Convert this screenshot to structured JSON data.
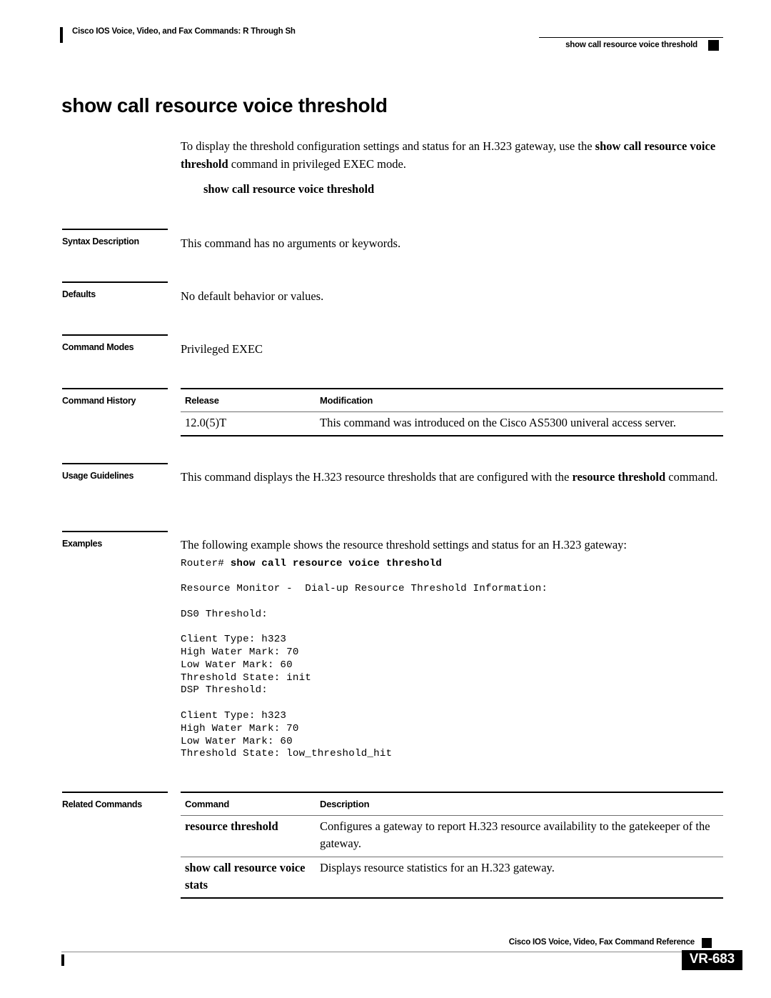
{
  "header": {
    "left_text": "Cisco IOS Voice, Video, and Fax Commands: R Through Sh",
    "right_text": "show call resource voice threshold"
  },
  "title": "show call resource voice threshold",
  "intro": {
    "text_part1": "To display the threshold configuration settings and status for an H.323 gateway, use the ",
    "bold1": "show call resource voice threshold",
    "text_part2": " command in privileged EXEC mode."
  },
  "syntax_line": "show call resource voice threshold",
  "sections": {
    "syntax_description": {
      "label": "Syntax Description",
      "body": "This command has no arguments or keywords."
    },
    "defaults": {
      "label": "Defaults",
      "body": "No default behavior or values."
    },
    "command_modes": {
      "label": "Command Modes",
      "body": "Privileged EXEC"
    },
    "command_history": {
      "label": "Command History",
      "columns": [
        "Release",
        "Modification"
      ],
      "rows": [
        {
          "release": "12.0(5)T",
          "modification": "This command was introduced on the Cisco AS5300 univeral access server."
        }
      ]
    },
    "usage_guidelines": {
      "label": "Usage Guidelines",
      "text_part1": "This command displays the H.323 resource thresholds that are configured with the ",
      "bold1": "resource threshold",
      "text_part2": " command."
    },
    "examples": {
      "label": "Examples",
      "body": "The following example shows the resource threshold settings and status for an H.323 gateway:",
      "code_prompt": "Router# ",
      "code_command": "show call resource voice threshold",
      "code_output": "Resource Monitor -  Dial-up Resource Threshold Information:\n\nDS0 Threshold:\n\nClient Type: h323\nHigh Water Mark: 70\nLow Water Mark: 60\nThreshold State: init\nDSP Threshold:\n\nClient Type: h323\nHigh Water Mark: 70\nLow Water Mark: 60\nThreshold State: low_threshold_hit"
    },
    "related_commands": {
      "label": "Related Commands",
      "columns": [
        "Command",
        "Description"
      ],
      "rows": [
        {
          "command": "resource threshold",
          "description": "Configures a gateway to report H.323 resource availability to the gatekeeper of the gateway."
        },
        {
          "command": "show call resource voice stats",
          "description": "Displays resource statistics for an H.323 gateway."
        }
      ]
    }
  },
  "footer": {
    "text": "Cisco IOS Voice, Video, Fax Command Reference",
    "page": "VR-683"
  }
}
